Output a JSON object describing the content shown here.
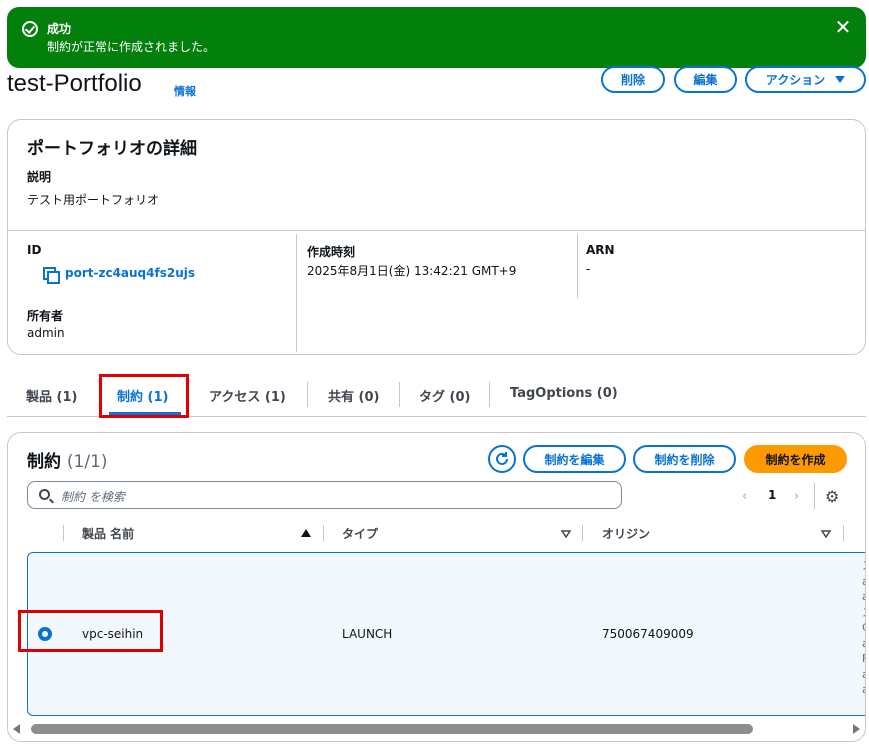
{
  "flash": {
    "title": "成功",
    "message": "制約が正常に作成されました。",
    "close": "✕"
  },
  "header": {
    "title": "test-Portfolio",
    "info": "情報",
    "delete_label": "削除",
    "edit_label": "編集",
    "actions_label": "アクション"
  },
  "details": {
    "heading": "ポートフォリオの詳細",
    "description_label": "説明",
    "description_value": "テスト用ポートフォリオ",
    "id_label": "ID",
    "id_value": "port-zc4auq4fs2ujs",
    "owner_label": "所有者",
    "owner_value": "admin",
    "created_label": "作成時刻",
    "created_value": "2025年8月1日(金) 13:42:21 GMT+9",
    "arn_label": "ARN",
    "arn_value": "-"
  },
  "tabs": [
    {
      "label": "製品 (1)"
    },
    {
      "label": "制約 (1)"
    },
    {
      "label": "アクセス (1)"
    },
    {
      "label": "共有 (0)"
    },
    {
      "label": "タグ (0)"
    },
    {
      "label": "TagOptions (0)"
    }
  ],
  "constraints": {
    "heading": "制約",
    "count": "(1/1)",
    "edit_label": "制約を編集",
    "delete_label": "制約を削除",
    "create_label": "制約を作成",
    "search_placeholder": "制約 を検索",
    "page": "1",
    "columns": [
      "製品 名前",
      "タイプ",
      "オリジン"
    ],
    "rows": [
      {
        "product": "vpc-seihin",
        "type": "LAUNCH",
        "origin": "750067409009"
      }
    ],
    "overflow_chars": [
      "ス",
      "a",
      "a",
      "ス",
      "C",
      "a",
      "F",
      "a",
      "a"
    ]
  },
  "colors": {
    "success": "#037f0c",
    "link": "#0972d3",
    "primary": "#ff9900",
    "highlight": "#e00000"
  }
}
